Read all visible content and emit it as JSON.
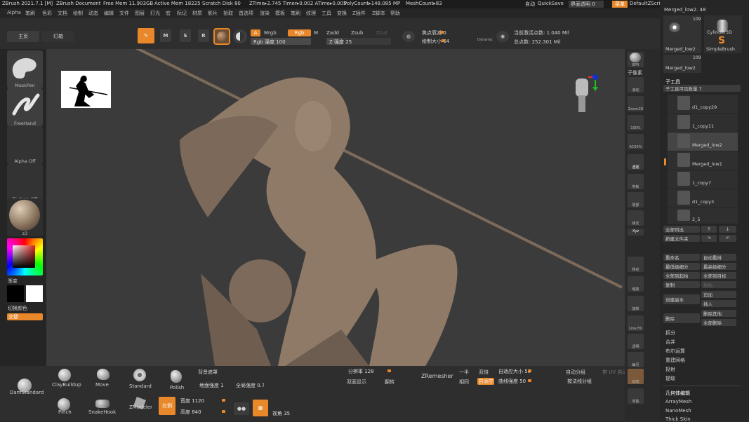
{
  "titlebar": {
    "app": "ZBrush 2021.7.1 [M]",
    "doc": "ZBrush Document",
    "free_mem": "Free Mem 11.903GB",
    "active_mem": "Active Mem 18225",
    "scratch": "Scratch Disk 80",
    "ztime": "ZTime▸2.745 Timer▸0.002 ATime▸0.005",
    "polycount": "PolyCount▸148.085 MP",
    "meshcount": "MeshCount▸83",
    "auto": "自动",
    "quicksave": "QuickSave",
    "transparency": "界面透明 0",
    "menu": "菜单",
    "script": "DefaultZScript"
  },
  "menus": [
    "Alpha",
    "笔刷",
    "色彩",
    "文档",
    "绘制",
    "动态",
    "编辑",
    "文件",
    "图层",
    "灯光",
    "宏",
    "标记",
    "材质",
    "影片",
    "拾取",
    "首选项",
    "渲染",
    "模板",
    "笔刷",
    "纹理",
    "工具",
    "变换",
    "Z插件",
    "Z脚本",
    "帮助"
  ],
  "topshelf": {
    "home": "主页",
    "lightbox": "灯箱",
    "edit": "编辑",
    "draw": "绘制",
    "move": "移动",
    "scale": "缩放",
    "rotate": "旋转",
    "a": "A",
    "mrgb": "Mrgb",
    "rgb": "Rgb",
    "m": "M",
    "rgb_intensity": "Rgb 强度 100",
    "zadd": "Zadd",
    "zsub": "Zsub",
    "zcut": "Zcut",
    "z_intensity": "Z 强度 25",
    "focal": "焦点衰减 0",
    "draw_size": "绘制大小 64",
    "dynamic": "Dynamic",
    "active_points": "当前激活点数: 1.040 Mil",
    "total_points": "总点数: 252.301 Mil"
  },
  "lefttray": {
    "maskpen": "MaskPen",
    "freehand": "FreeHand",
    "alpha_off": "Alpha Off",
    "texture_off": "Texture Off",
    "material": "z3",
    "gradient": "渐变",
    "switch_color": "切换颜色",
    "alternate": "交替"
  },
  "bottomshelf": {
    "brushes": [
      "ClayBuildup",
      "Move",
      "Standard",
      "Polish",
      "DamStandard",
      "Pinch",
      "SnakeHook",
      "ZModeler"
    ],
    "bg_mask": "背景遮罩",
    "ground_intensity": "地面强度 1",
    "global_intensity": "全局强度 0.7",
    "ratio": "比例",
    "width": "宽度 1120",
    "height": "高度 840",
    "angle": "视角 35",
    "resolution": "分辨率 128",
    "dual_display": "双面显示",
    "flip": "翻转",
    "zremesher": "ZRemesher",
    "half": "一半",
    "same": "相同",
    "double": "双倍",
    "adaptive": "自适应",
    "adaptive_size": "自适应大小 50",
    "curve_intensity": "曲线强度 50",
    "auto_group": "自动分组",
    "by_normal": "按法线分组",
    "uv_auto": "带 UV 自动"
  },
  "righticons": [
    "BPR",
    "子像素",
    "滚动",
    "Zoom2D",
    "100%",
    "AC50%",
    "透视",
    "地板",
    "局部",
    "锁定",
    "Xyz",
    "移动",
    "缩放",
    "旋转",
    "Line Fill",
    "透明",
    "幽灵",
    "动态",
    "单独"
  ],
  "rightpanel": {
    "top_label": "Merged_low2. 48",
    "thumbs": [
      {
        "name": "Merged_low2",
        "count": "109"
      },
      {
        "name": "Cylinder3D"
      },
      {
        "name": "SimpleBrush"
      },
      {
        "name": "Merged_low2",
        "count": "109"
      }
    ],
    "subtool_title": "子工具",
    "visible_count": "子工具可见数量 7",
    "subtools": [
      "d1_copy29",
      "1_copy11",
      "Merged_low2",
      "Merged_low1",
      "1_copy7",
      "d1_copy3",
      "2_5"
    ],
    "list_all": "全部列出",
    "new_folder": "新建文件夹",
    "rename": "重命名",
    "auto_reorder": "自动重排",
    "lowest_sub": "最低级细分",
    "highest_sub": "最高级细分",
    "all_to_start": "全部到起始",
    "all_to_target": "全部到目标",
    "copy": "复制",
    "paste": "粘贴",
    "create_copy": "创建副本",
    "append": "追加",
    "insert": "插入",
    "delete": "删除",
    "delete_other": "删除其他",
    "delete_all": "全部删除",
    "split": "拆分",
    "merge": "合并",
    "boolean": "布尔运算",
    "remesh": "重建网格",
    "project": "投射",
    "extract": "提取",
    "geometry_edit": "几何体编辑",
    "arraymesh": "ArrayMesh",
    "nanomesh": "NanoMesh",
    "thickskin": "Thick Skin"
  },
  "colors": {
    "accent": "#e8882a",
    "bg": "#2b2b2b",
    "viewport": "#3b3b3b",
    "sculpt": "#8f7a68"
  }
}
